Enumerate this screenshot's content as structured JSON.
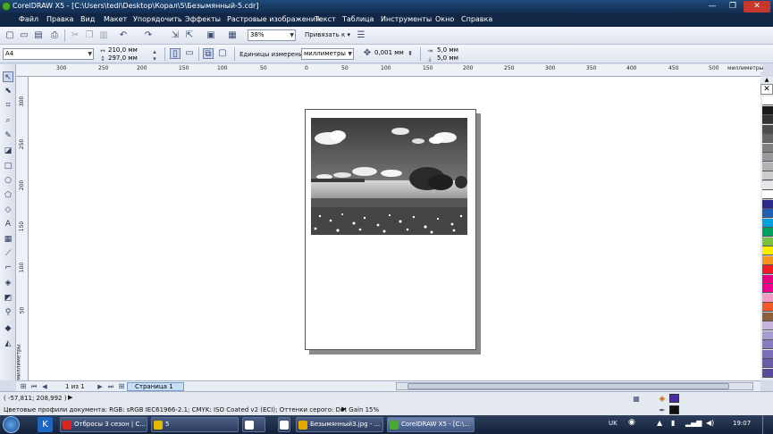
{
  "window": {
    "title": "CorelDRAW X5 - [C:\\Users\\tedi\\Desktop\\Корал\\5\\Безымянный-5.cdr]",
    "minimize": "—",
    "restore": "❐",
    "close": "✕"
  },
  "menu": [
    {
      "label": "Файл"
    },
    {
      "label": "Правка"
    },
    {
      "label": "Вид"
    },
    {
      "label": "Макет"
    },
    {
      "label": "Упорядочить"
    },
    {
      "label": "Эффекты"
    },
    {
      "label": "Растровые изображения"
    },
    {
      "label": "Текст"
    },
    {
      "label": "Таблица"
    },
    {
      "label": "Инструменты"
    },
    {
      "label": "Окно"
    },
    {
      "label": "Справка"
    }
  ],
  "toolbar": {
    "zoom": "38%",
    "snap_label": "Привязать к"
  },
  "propbar": {
    "page_size": "A4",
    "width": "210,0 мм",
    "height": "297,0 мм",
    "units_label": "Единицы измерения:",
    "units_value": "миллиметры",
    "nudge": "0,001 мм",
    "dup_x": "5,0 мм",
    "dup_y": "5,0 мм"
  },
  "ruler": {
    "unit": "миллиметры",
    "h_ticks": [
      "300",
      "250",
      "200",
      "150",
      "100",
      "50",
      "0",
      "50",
      "100",
      "150",
      "200",
      "250",
      "300",
      "350",
      "400",
      "450",
      "500"
    ],
    "v_ticks": [
      "300",
      "250",
      "200",
      "150",
      "100",
      "50"
    ]
  },
  "pagenav": {
    "counter": "1 из 1",
    "page_tab": "Страница 1"
  },
  "status": {
    "coords": "( -57,811; 208,992 )",
    "profiles": "Цветовые профили документа: RGB: sRGB IEC61966-2.1; CMYK: ISO Coated v2 (ECI); Оттенки серого: Dot Gain 15%",
    "fill_color": "#4a2ba0",
    "outline_color": "#111111"
  },
  "palette": [
    "#ffffff",
    "#1a1a1a",
    "#333333",
    "#4d4d4d",
    "#666666",
    "#808080",
    "#999999",
    "#b3b3b3",
    "#cccccc",
    "#e6e6e6",
    "#ffffff",
    "#2e2a8c",
    "#1f5fb8",
    "#00a0e0",
    "#00a060",
    "#7ac143",
    "#ffed00",
    "#f7941d",
    "#ee1c25",
    "#e6007e",
    "#ec008c",
    "#f49ac2",
    "#f15a24",
    "#8b5e3c",
    "#c7b2de",
    "#a79bd0",
    "#8a7cc2",
    "#7c6bb7",
    "#6b5aa8",
    "#5a4a99"
  ],
  "taskbar": {
    "tasks": [
      {
        "label": "Отбросы 3 сезон | С...",
        "color": "#d8261c"
      },
      {
        "label": "5",
        "color": "#e6b800"
      },
      {
        "label": "",
        "color": "#ffffff"
      },
      {
        "label": "Безымянный3.jpg - ...",
        "color": "#e6a800"
      },
      {
        "label": "CorelDRAW X5 - [C:\\...",
        "color": "#4aa830"
      }
    ],
    "lang": "UK",
    "clock": "19:07"
  }
}
